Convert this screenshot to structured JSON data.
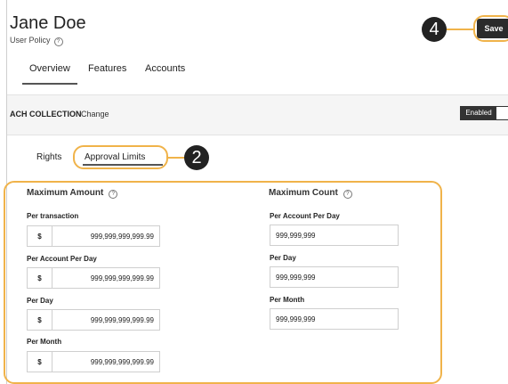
{
  "header": {
    "title": "Jane Doe",
    "subtitle": "User Policy",
    "save_label": "Save",
    "callout_save": "4"
  },
  "main_tabs": [
    {
      "label": "Overview",
      "active": true
    },
    {
      "label": "Features",
      "active": false
    },
    {
      "label": "Accounts",
      "active": false
    }
  ],
  "ach": {
    "name": "ACH COLLECTION",
    "change_label": "Change",
    "toggle_label": "Enabled"
  },
  "sub_tabs": {
    "rights": "Rights",
    "approval_limits": "Approval Limits",
    "callout": "2"
  },
  "maximum_amount": {
    "heading": "Maximum Amount",
    "fields": [
      {
        "label": "Per transaction",
        "currency": "$",
        "value": "999,999,999,999.99"
      },
      {
        "label": "Per Account Per Day",
        "currency": "$",
        "value": "999,999,999,999.99"
      },
      {
        "label": "Per Day",
        "currency": "$",
        "value": "999,999,999,999.99"
      },
      {
        "label": "Per Month",
        "currency": "$",
        "value": "999,999,999,999.99"
      }
    ]
  },
  "maximum_count": {
    "heading": "Maximum Count",
    "fields": [
      {
        "label": "Per Account Per Day",
        "value": "999,999,999"
      },
      {
        "label": "Per Day",
        "value": "999,999,999"
      },
      {
        "label": "Per Month",
        "value": "999,999,999"
      }
    ]
  },
  "colors": {
    "accent": "#f0b34a",
    "button": "#2b2b2b"
  }
}
